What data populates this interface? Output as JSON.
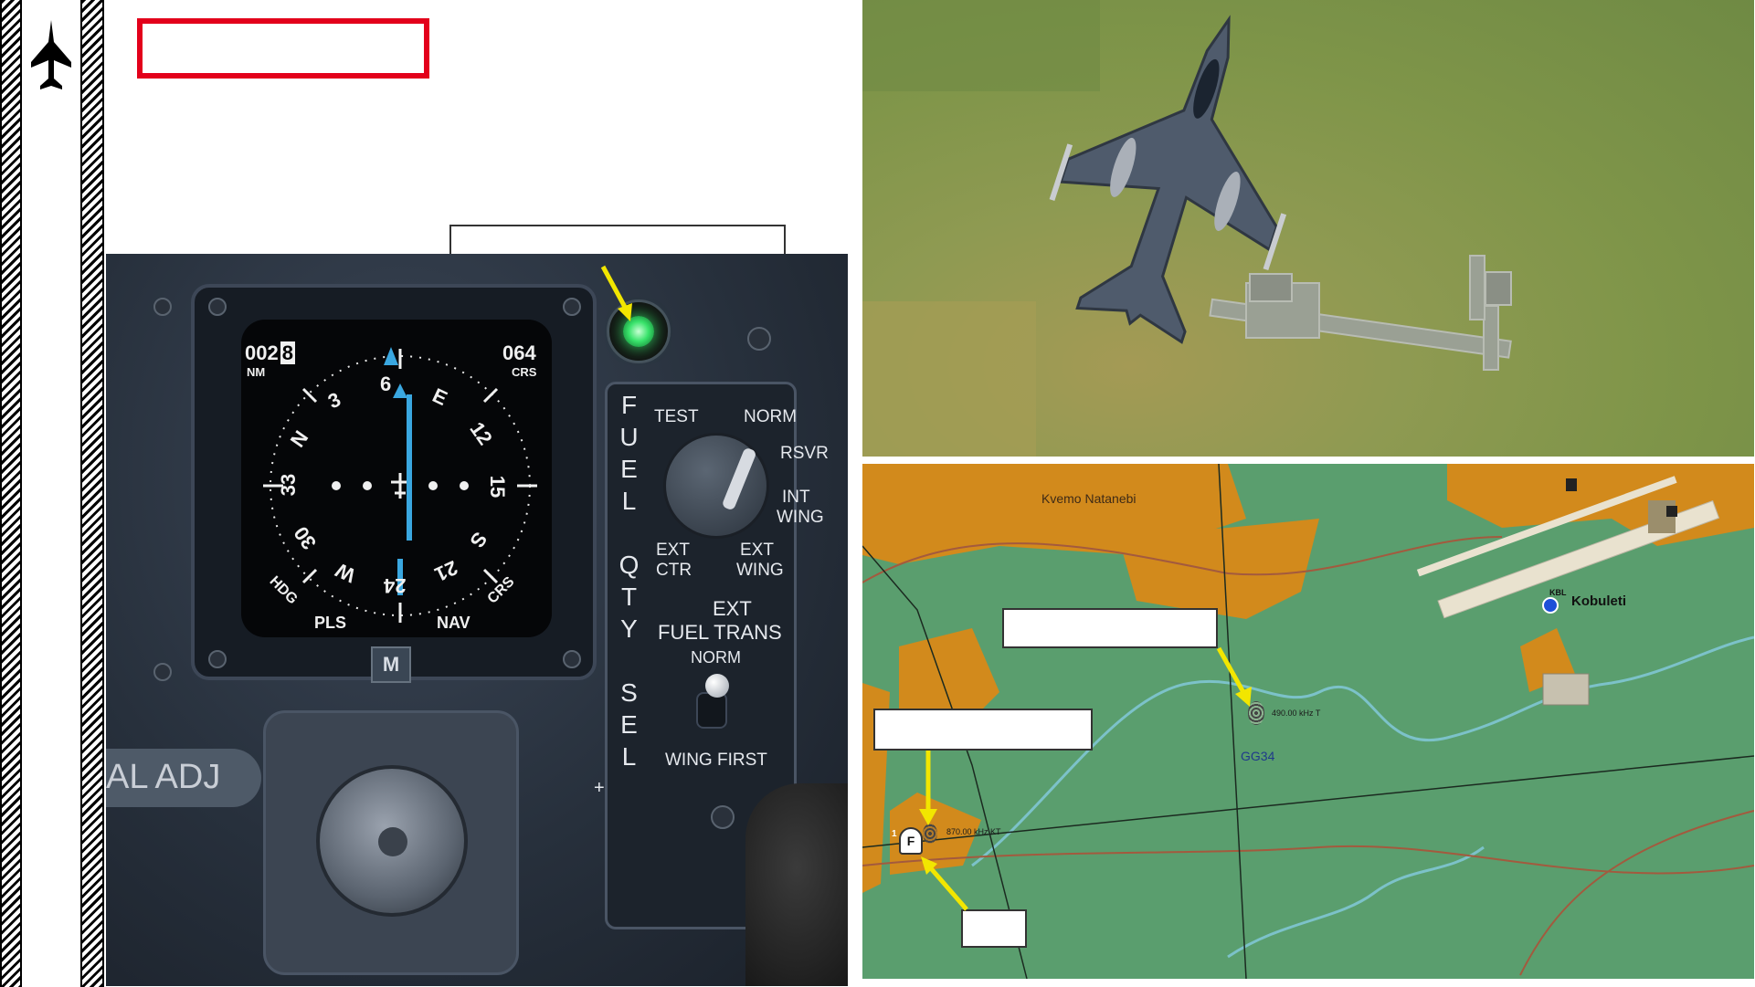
{
  "panel": {
    "hsi": {
      "distance": "002",
      "distance_cursor": "8",
      "distance_unit": "NM",
      "course": "064",
      "course_unit": "CRS",
      "hdg_label": "HDG",
      "crs_label": "CRS",
      "pls_label": "PLS",
      "nav_label": "NAV",
      "mode_button": "M",
      "compass": [
        "N",
        "3",
        "6",
        "E",
        "12",
        "15",
        "S",
        "21",
        "24",
        "W",
        "30",
        "33"
      ]
    },
    "fuel_qty_sel": {
      "title": "FUEL QTY SEL",
      "test": "TEST",
      "norm": "NORM",
      "rsvr": "RSVR",
      "int_wing_1": "INT",
      "int_wing_2": "WING",
      "ext_ctr_1": "EXT",
      "ext_ctr_2": "CTR",
      "ext_wing_1": "EXT",
      "ext_wing_2": "WING"
    },
    "ext_fuel_trans": {
      "line1": "EXT",
      "line2": "FUEL TRANS",
      "norm": "NORM",
      "wing_first": "WING FIRST"
    },
    "al_adj": "AL ADJ"
  },
  "map": {
    "town": "Kvemo Natanebi",
    "airbase": "Kobuleti",
    "airbase_code": "KBL",
    "beacon1_freq": "490.00 kHz T",
    "beacon1_id": "GG34",
    "beacon2_freq": "870.00 kHz KT",
    "marker_letter": "F",
    "marker_number": "1"
  },
  "colors": {
    "map_land": "#5a9e6e",
    "map_urban": "#d28a1c",
    "callout_arrow": "#f2e600",
    "indicator_light": "#39e36b",
    "hsi_needle": "#3aa7e0",
    "highlight_frame": "#e3001b"
  },
  "icons": {
    "rail": "jet-silhouette-icon",
    "beacon": "ndb-beacon-icon",
    "airbase": "airbase-icon"
  }
}
